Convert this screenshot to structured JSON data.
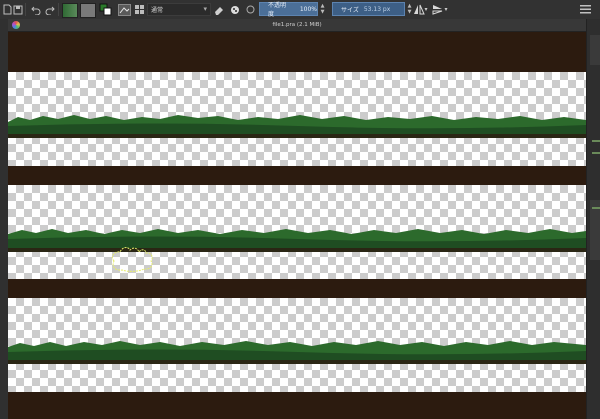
{
  "toolbar": {
    "blend_mode": "通常",
    "opacity_label": "不透明度",
    "opacity_value": "100%",
    "size_label": "サイズ",
    "size_value": "53.13 px"
  },
  "canvas_window": {
    "title": "file1.pra (2.1 MiB)"
  },
  "colors": {
    "ground": "#2c1b0f",
    "grass": "#2c6a2c",
    "selection_outline": "#e6ec6a",
    "slider": "#4b6f98"
  }
}
